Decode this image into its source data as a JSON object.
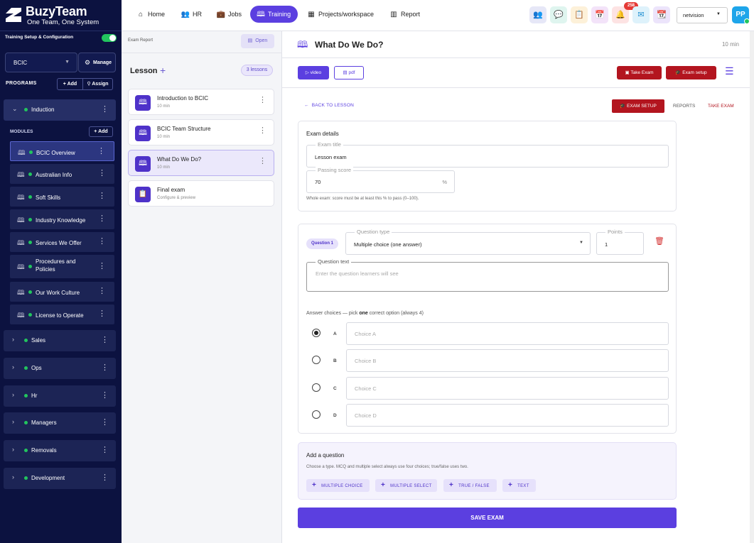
{
  "brand": {
    "title": "BuzyTeam",
    "tagline": "One Team, One System"
  },
  "sidebar": {
    "training_setup_label": "Training Setup & Configuration",
    "org_value": "BCIC",
    "manage_label": "Manage",
    "programs_label": "PROGRAMS",
    "add_label": "+ Add",
    "assign_label": "Assign",
    "modules_label": "MODULES",
    "add_module_label": "+ Add",
    "open_program": "Induction",
    "modules": [
      {
        "label": "BCIC Overview"
      },
      {
        "label": "Australian Info"
      },
      {
        "label": "Soft Skills"
      },
      {
        "label": "Industry Knowledge"
      },
      {
        "label": "Services We Offer"
      },
      {
        "label": "Procedures and Policies"
      },
      {
        "label": "Our Work Culture"
      },
      {
        "label": "License to Operate"
      }
    ],
    "programs": [
      {
        "label": "Sales"
      },
      {
        "label": "Ops"
      },
      {
        "label": "Hr"
      },
      {
        "label": "Managers"
      },
      {
        "label": "Removals"
      },
      {
        "label": "Development"
      }
    ]
  },
  "topnav": {
    "items": [
      {
        "label": "Home"
      },
      {
        "label": "HR"
      },
      {
        "label": "Jobs"
      },
      {
        "label": "Training"
      },
      {
        "label": "Projects/workspace"
      },
      {
        "label": "Report"
      }
    ],
    "notification_count": "258",
    "user_select": "netvision",
    "avatar_initials": "PP"
  },
  "middle": {
    "exam_report_label": "Exam Report",
    "open_label": "Open",
    "lesson_heading": "Lesson",
    "lesson_count": "3 lessons",
    "lessons": [
      {
        "title": "Introduction to BCIC",
        "sub": "10 min"
      },
      {
        "title": "BCIC Team Structure",
        "sub": "10 min"
      },
      {
        "title": "What Do We Do?",
        "sub": "10 min"
      },
      {
        "title": "Final exam",
        "sub": "Configure & preview"
      }
    ]
  },
  "main": {
    "title": "What Do We Do?",
    "duration": "10 min",
    "video_label": "video",
    "pdf_label": "pdf",
    "take_exam_label": "Take Exam",
    "exam_setup_label": "Exam setup",
    "back_label": "BACK TO LESSON",
    "tab_setup": "EXAM SETUP",
    "tab_reports": "REPORTS",
    "tab_take": "TAKE EXAM",
    "exam_details": {
      "heading": "Exam details",
      "title_label": "Exam title",
      "title_value": "Lesson exam",
      "passing_label": "Passing score",
      "passing_value": "70",
      "passing_unit": "%",
      "hint": "Whole exam: score must be at least this % to pass (0–100)."
    },
    "question": {
      "badge": "Question 1",
      "type_label": "Question type",
      "type_value": "Multiple choice (one answer)",
      "points_label": "Points",
      "points_value": "1",
      "text_label": "Question text",
      "text_placeholder": "Enter the question learners will see",
      "answers_prefix": "Answer choices",
      "answers_mid": " — pick ",
      "answers_bold": "one",
      "answers_suffix": " correct option (always 4)",
      "choices": [
        {
          "letter": "A",
          "placeholder": "Choice A",
          "selected": true
        },
        {
          "letter": "B",
          "placeholder": "Choice B",
          "selected": false
        },
        {
          "letter": "C",
          "placeholder": "Choice C",
          "selected": false
        },
        {
          "letter": "D",
          "placeholder": "Choice D",
          "selected": false
        }
      ]
    },
    "add_question": {
      "heading": "Add a question",
      "sub": "Choose a type. MCQ and multiple select always use four choices; true/false uses two.",
      "types": [
        "MULTIPLE CHOICE",
        "MULTIPLE SELECT",
        "TRUE / FALSE",
        "TEXT"
      ]
    },
    "save_label": "SAVE EXAM"
  },
  "colors": {
    "brand_purple": "#5b3fe0",
    "sidebar_bg": "#0c1240",
    "accent_red": "#b3151f",
    "online_green": "#22c55e"
  }
}
